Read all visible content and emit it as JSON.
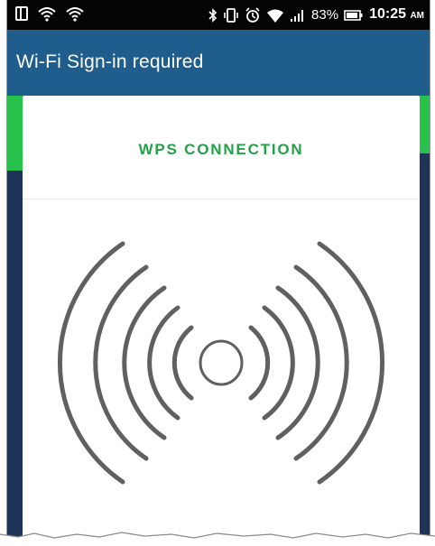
{
  "status_bar": {
    "battery": "83%",
    "time": "10:25",
    "ampm": "AM",
    "icons": [
      "screenshot-icon",
      "wifi-icon",
      "wifi-icon",
      "bluetooth-icon",
      "vibrate-icon",
      "alarm-icon",
      "wifi-signal-icon",
      "cell-signal-icon",
      "battery-icon"
    ]
  },
  "app_bar": {
    "title": "Wi-Fi Sign-in required"
  },
  "card": {
    "title": "WPS CONNECTION",
    "graphic": "wps-signal-icon"
  },
  "colors": {
    "status_bar": "#050505",
    "app_bar": "#1f5e8c",
    "background": "#1f3359",
    "accent_green": "#27c24c",
    "title_green": "#24a14a",
    "graphic_gray": "#606060"
  }
}
